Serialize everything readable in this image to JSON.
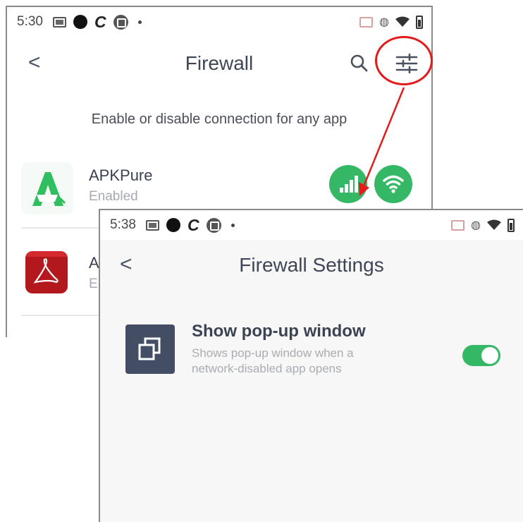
{
  "back_screen": {
    "status_time": "5:30",
    "title": "Firewall",
    "back_glyph": "<",
    "subtitle": "Enable or disable connection for any app",
    "apps": [
      {
        "name": "APKPure",
        "status": "Enabled",
        "icon": "apkpure-logo"
      },
      {
        "name": "A",
        "status": "E",
        "icon": "adobe-acrobat-logo"
      }
    ],
    "icons": [
      "search-icon",
      "tune-settings-icon",
      "mobile-data-icon",
      "wifi-icon"
    ]
  },
  "front_screen": {
    "status_time": "5:38",
    "title": "Firewall Settings",
    "back_glyph": "<",
    "setting": {
      "title": "Show pop-up window",
      "description_line1": "Shows pop-up window when a",
      "description_line2": "network-disabled app opens",
      "enabled": true,
      "icon": "popup-window-icon"
    }
  },
  "colors": {
    "accent_green": "#35b866",
    "annotation_red": "#e21c1c",
    "title_text": "#3e4656",
    "muted_text": "#a8acb3",
    "dark_tile": "#434d63"
  }
}
